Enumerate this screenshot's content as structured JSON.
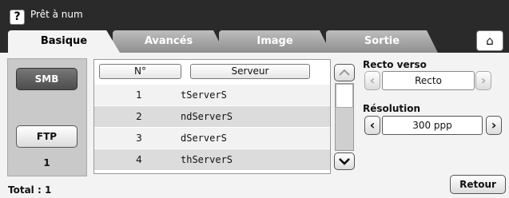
{
  "header": {
    "help_label": "?",
    "title": "Prêt à num"
  },
  "tabs": [
    {
      "label": "Basique",
      "active": true
    },
    {
      "label": "Avancés",
      "active": false
    },
    {
      "label": "Image",
      "active": false
    },
    {
      "label": "Sortie",
      "active": false
    }
  ],
  "home_icon": "home-icon",
  "left": {
    "smb_label": "SMB",
    "ftp_label": "FTP",
    "ftp_count": "1"
  },
  "table": {
    "columns": [
      "N°",
      "Serveur"
    ],
    "rows": [
      {
        "no": "1",
        "server": "tServerS"
      },
      {
        "no": "2",
        "server": "ndServerS"
      },
      {
        "no": "3",
        "server": "dServerS"
      },
      {
        "no": "4",
        "server": "thServerS"
      }
    ]
  },
  "right": {
    "recto_label": "Recto verso",
    "recto_value": "Recto",
    "resolution_label": "Résolution",
    "resolution_value": "300 ppp"
  },
  "footer": {
    "total": "Total : 1",
    "back_label": "Retour"
  }
}
